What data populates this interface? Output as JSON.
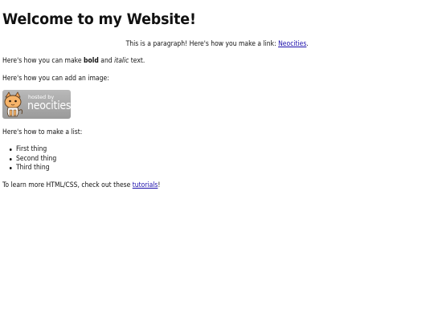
{
  "heading": "Welcome to my Website!",
  "intro": {
    "text_before": "This is a paragraph! Here's how you make a link: ",
    "link": "Neocities",
    "text_after": "."
  },
  "formatting": {
    "before": "Here's how you can make ",
    "bold": "bold",
    "middle": " and ",
    "italic": "italic",
    "after": " text."
  },
  "image_intro": "Here's how you can add an image:",
  "image": {
    "label_small": "hosted by",
    "label_big": "neocities",
    "icon": "neocities-cat-logo"
  },
  "list_intro": "Here's how to make a list:",
  "list_items": [
    "First thing",
    "Second thing",
    "Third thing"
  ],
  "outro": {
    "before": "To learn more HTML/CSS, check out these ",
    "link": "tutorials",
    "after": "!"
  },
  "colors": {
    "link": "#1a0dab",
    "text": "#111111",
    "background": "#ffffff"
  }
}
